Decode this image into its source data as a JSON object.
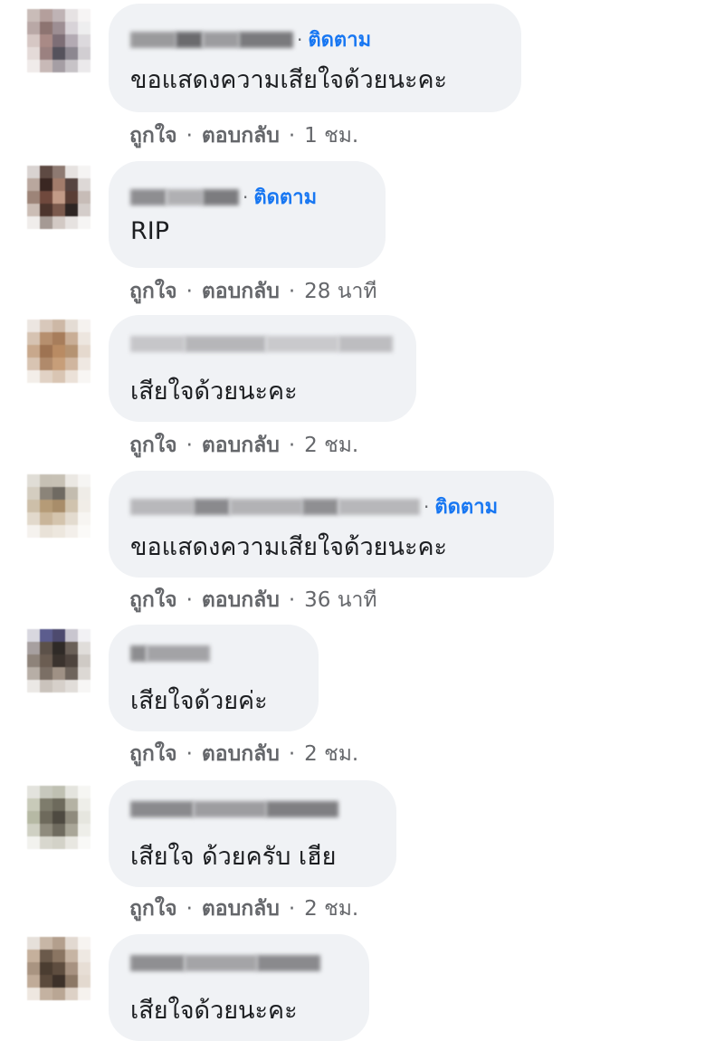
{
  "comments": [
    {
      "follow_label": "ติดตาม",
      "text": "ขอแสดงความเสียใจด้วยนะคะ",
      "like": "ถูกใจ",
      "reply": "ตอบกลับ",
      "time": "1 ชม."
    },
    {
      "follow_label": "ติดตาม",
      "text": "RIP",
      "like": "ถูกใจ",
      "reply": "ตอบกลับ",
      "time": "28 นาที"
    },
    {
      "follow_label": "",
      "text": "เสียใจด้วยนะคะ",
      "like": "ถูกใจ",
      "reply": "ตอบกลับ",
      "time": "2 ชม."
    },
    {
      "follow_label": "ติดตาม",
      "text": "ขอแสดงความเสียใจด้วยนะคะ",
      "like": "ถูกใจ",
      "reply": "ตอบกลับ",
      "time": "36 นาที"
    },
    {
      "follow_label": "",
      "text": "เสียใจด้วยค่ะ",
      "like": "ถูกใจ",
      "reply": "ตอบกลับ",
      "time": "2 ชม."
    },
    {
      "follow_label": "",
      "text": "เสียใจ ด้วยครับ เฮีย",
      "like": "ถูกใจ",
      "reply": "ตอบกลับ",
      "time": "2 ชม."
    },
    {
      "follow_label": "",
      "text": "เสียใจด้วยนะคะ",
      "like": "",
      "reply": "",
      "time": ""
    }
  ],
  "colors": {
    "bubble": "#f0f2f5",
    "follow": "#1877f2",
    "meta": "#65676b",
    "text": "#1c1e21"
  }
}
